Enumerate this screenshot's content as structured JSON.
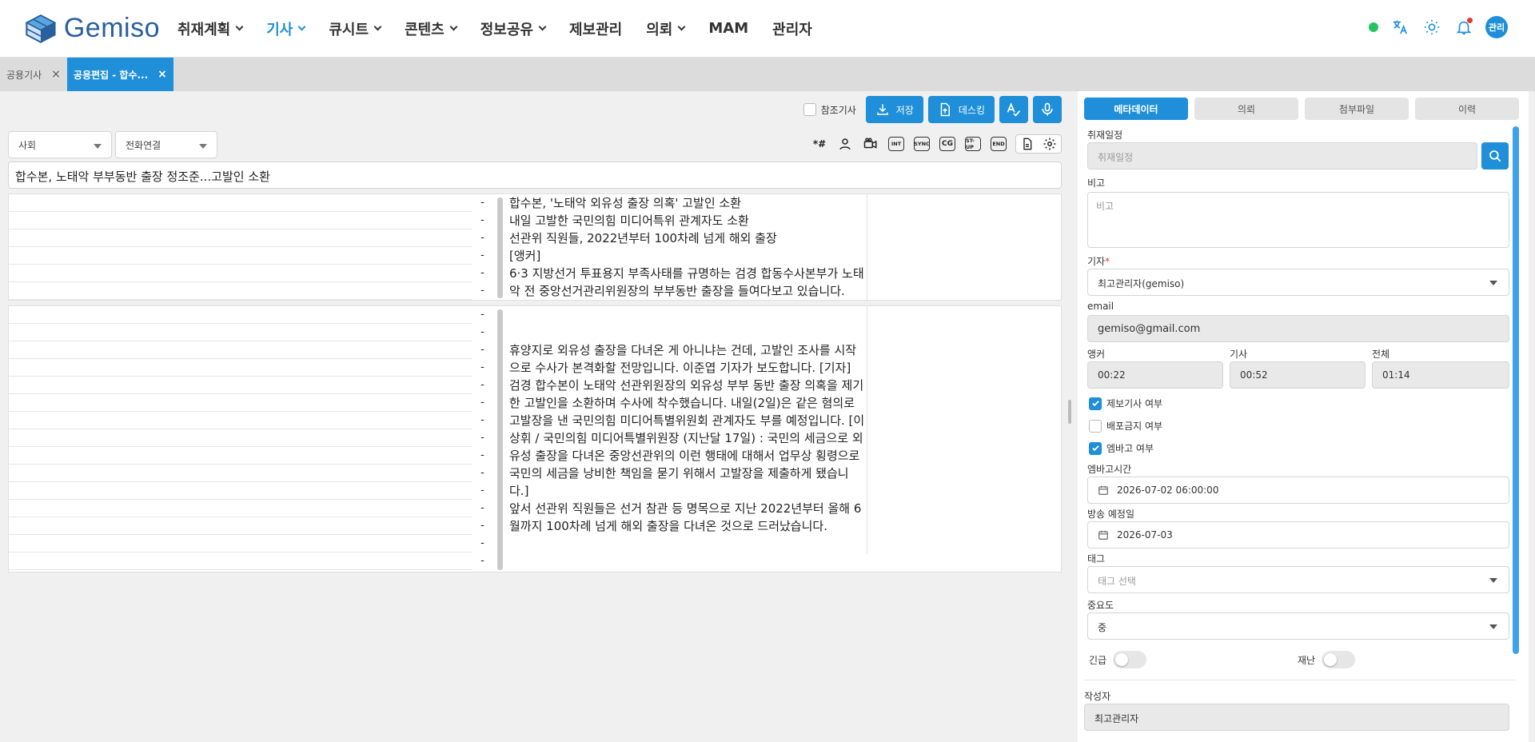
{
  "app": {
    "logo_text": "Gemiso",
    "brand_color": "#1e8fd8"
  },
  "nav": {
    "items": [
      {
        "label": "취재계획",
        "dropdown": true
      },
      {
        "label": "기사",
        "dropdown": true,
        "active": true
      },
      {
        "label": "큐시트",
        "dropdown": true
      },
      {
        "label": "콘텐츠",
        "dropdown": true
      },
      {
        "label": "정보공유",
        "dropdown": true
      },
      {
        "label": "제보관리",
        "dropdown": false
      },
      {
        "label": "의뢰",
        "dropdown": true
      },
      {
        "label": "MAM",
        "dropdown": false
      },
      {
        "label": "관리자",
        "dropdown": false
      }
    ],
    "avatar": "관리"
  },
  "tabs": [
    {
      "label": "공용기사",
      "close": "×"
    },
    {
      "label": "공용편집 - 합수...",
      "close": "×",
      "active": true
    }
  ],
  "toolbar": {
    "reference_label": "참조기사",
    "save_label": "저장",
    "desking_label": "데스킹"
  },
  "selects": {
    "category": "사회",
    "connection": "전화연결"
  },
  "article_title": "합수본, 노태악 부부동반 출장 정조준...고발인 소환",
  "cue_tools": {
    "hash": "*#",
    "int": "INT",
    "sync": "SYNC",
    "cg": "CG",
    "stup": "ST-UP",
    "end": "END"
  },
  "block1": {
    "lines": [
      "합수본, '노태악 외유성 출장 의혹' 고발인 소환",
      "내일 고발한 국민의힘 미디어특위 관계자도 소환",
      "선관위 직원들, 2022년부터 100차례 넘게 해외 출장",
      "[앵커]",
      "6·3 지방선거 투표용지 부족사태를 규명하는 검경 합동수사본부가 노태악 전 중앙선거관리위원장의 부부동반 출장을 들여다보고 있습니다."
    ]
  },
  "block2": {
    "lines": [
      "휴양지로 외유성 출장을 다녀온 게 아니냐는 건데, 고발인 조사를 시작으로 수사가 본격화할 전망입니다. 이준엽 기자가 보도합니다. [기자]",
      "검경 합수본이 노태악 선관위원장의 외유성 부부 동반 출장 의혹을 제기한 고발인을 소환하며 수사에 착수했습니다. 내일(2일)은 같은 혐의로 고발장을 낸 국민의힘 미디어특별위원회 관계자도 부를 예정입니다. [이상휘 / 국민의힘 미디어특별위원장 (지난달 17일) : 국민의 세금으로 외유성 출장을 다녀온 중앙선관위의 이런 행태에 대해서 업무상 횡령으로 국민의 세금을 낭비한 책임을 묻기 위해서 고발장을 제출하게 됐습니다.]",
      "앞서 선관위 직원들은 선거 참관 등 명목으로 지난 2022년부터 올해 6월까지 100차례 넘게 해외 출장을 다녀온 것으로 드러났습니다."
    ]
  },
  "dash": "-",
  "panel": {
    "tabs": [
      "메타데이터",
      "의뢰",
      "첨부파일",
      "이력"
    ],
    "schedule": {
      "label": "취재일정",
      "placeholder": "취재일정"
    },
    "note": {
      "label": "비고",
      "placeholder": "비고"
    },
    "reporter": {
      "label": "기자",
      "required": "*",
      "value": "최고관리자(gemiso)"
    },
    "email": {
      "label": "email",
      "value": "gemiso@gmail.com"
    },
    "anchor": {
      "label": "앵커",
      "value": "00:22"
    },
    "article": {
      "label": "기사",
      "value": "00:52"
    },
    "total": {
      "label": "전체",
      "value": "01:14"
    },
    "checks": [
      {
        "label": "제보기사 여부",
        "checked": true
      },
      {
        "label": "배포금지 여부",
        "checked": false
      },
      {
        "label": "엠바고 여부",
        "checked": true
      }
    ],
    "embargo_time": {
      "label": "엠바고시간",
      "value": "2026-07-02 06:00:00"
    },
    "broadcast_date": {
      "label": "방송 예정일",
      "value": "2026-07-03"
    },
    "tag": {
      "label": "태그",
      "placeholder": "태그 선택"
    },
    "importance": {
      "label": "중요도",
      "value": "중"
    },
    "urgent": {
      "label": "긴급"
    },
    "disaster": {
      "label": "재난"
    },
    "author": {
      "label": "작성자",
      "value": "최고관리자"
    }
  }
}
